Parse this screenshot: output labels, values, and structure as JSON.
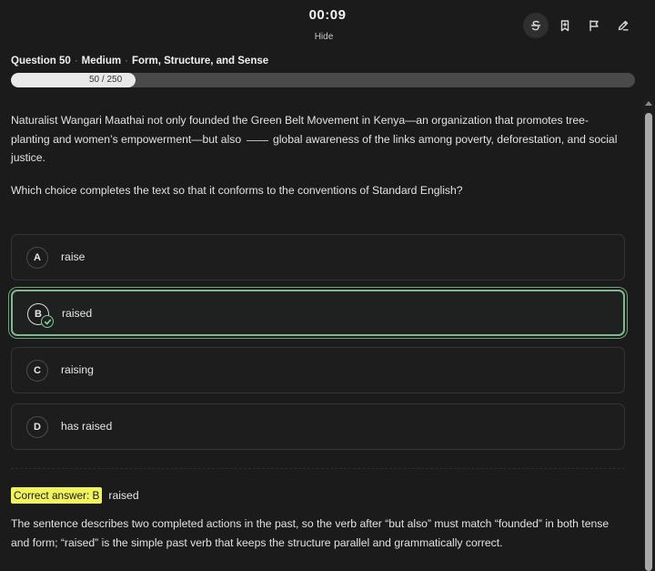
{
  "header": {
    "timer": "00:09",
    "hide_label": "Hide",
    "tools": [
      "strikethrough-icon",
      "bookmark-icon",
      "flag-icon",
      "pencil-icon"
    ]
  },
  "question_meta": {
    "number": "Question 50",
    "difficulty": "Medium",
    "topic": "Form, Structure, and Sense"
  },
  "progress": {
    "label": "50 / 250",
    "fraction": 0.2
  },
  "passage": {
    "before": "Naturalist Wangari Maathai not only founded the Green Belt Movement in Kenya—an organization that promotes tree-planting and women’s empowerment—but also",
    "after": "global awareness of the links among poverty, deforestation, and social justice."
  },
  "prompt": "Which choice completes the text so that it conforms to the conventions of Standard English?",
  "choices": [
    {
      "letter": "A",
      "text": "raise"
    },
    {
      "letter": "B",
      "text": "raised"
    },
    {
      "letter": "C",
      "text": "raising"
    },
    {
      "letter": "D",
      "text": "has raised"
    }
  ],
  "selected_choice": "B",
  "answer": {
    "label": "Correct answer: B",
    "text": "raised"
  },
  "explanation": "The sentence describes two completed actions in the past, so the verb after “but also” must match “founded” in both tense and form; “raised” is the simple past verb that keeps the structure parallel and grammatically correct.",
  "colors": {
    "background": "#1b1b1b",
    "correct": "#7fb98d",
    "highlight": "#f1f35a"
  }
}
